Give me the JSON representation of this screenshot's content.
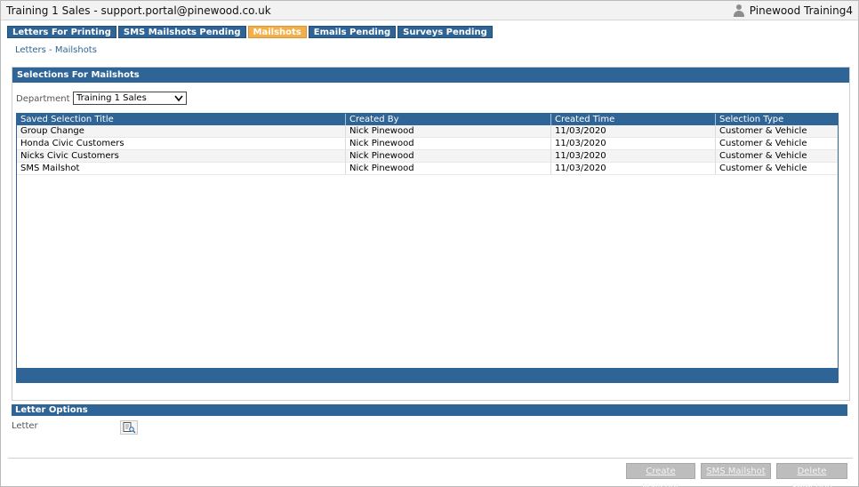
{
  "window": {
    "title": "Training 1 Sales - support.portal@pinewood.co.uk",
    "user_name": "Pinewood Training4"
  },
  "tabs": [
    {
      "label": "Letters For Printing",
      "active": false
    },
    {
      "label": "SMS Mailshots Pending",
      "active": false
    },
    {
      "label": "Mailshots",
      "active": true
    },
    {
      "label": "Emails Pending",
      "active": false
    },
    {
      "label": "Surveys Pending",
      "active": false
    }
  ],
  "breadcrumb": "Letters - Mailshots",
  "selections": {
    "header": "Selections For Mailshots",
    "department_label": "Department",
    "department_value": "Training 1 Sales",
    "columns": [
      "Saved Selection Title",
      "Created By",
      "Created Time",
      "Selection Type"
    ],
    "rows": [
      [
        "Group Change",
        "Nick Pinewood",
        "11/03/2020",
        "Customer & Vehicle"
      ],
      [
        "Honda Civic Customers",
        "Nick Pinewood",
        "11/03/2020",
        "Customer & Vehicle"
      ],
      [
        "Nicks Civic Customers",
        "Nick Pinewood",
        "11/03/2020",
        "Customer & Vehicle"
      ],
      [
        "SMS Mailshot",
        "Nick Pinewood",
        "11/03/2020",
        "Customer & Vehicle"
      ]
    ]
  },
  "letter_options": {
    "header": "Letter Options",
    "letter_label": "Letter"
  },
  "buttons": {
    "create": "Create Mailshot",
    "sms": "SMS Mailshot",
    "delete": "Delete Selection"
  },
  "colors": {
    "accent": "#2f6496",
    "active_tab": "#f3b04a",
    "disabled_button": "#bdbdbd"
  }
}
